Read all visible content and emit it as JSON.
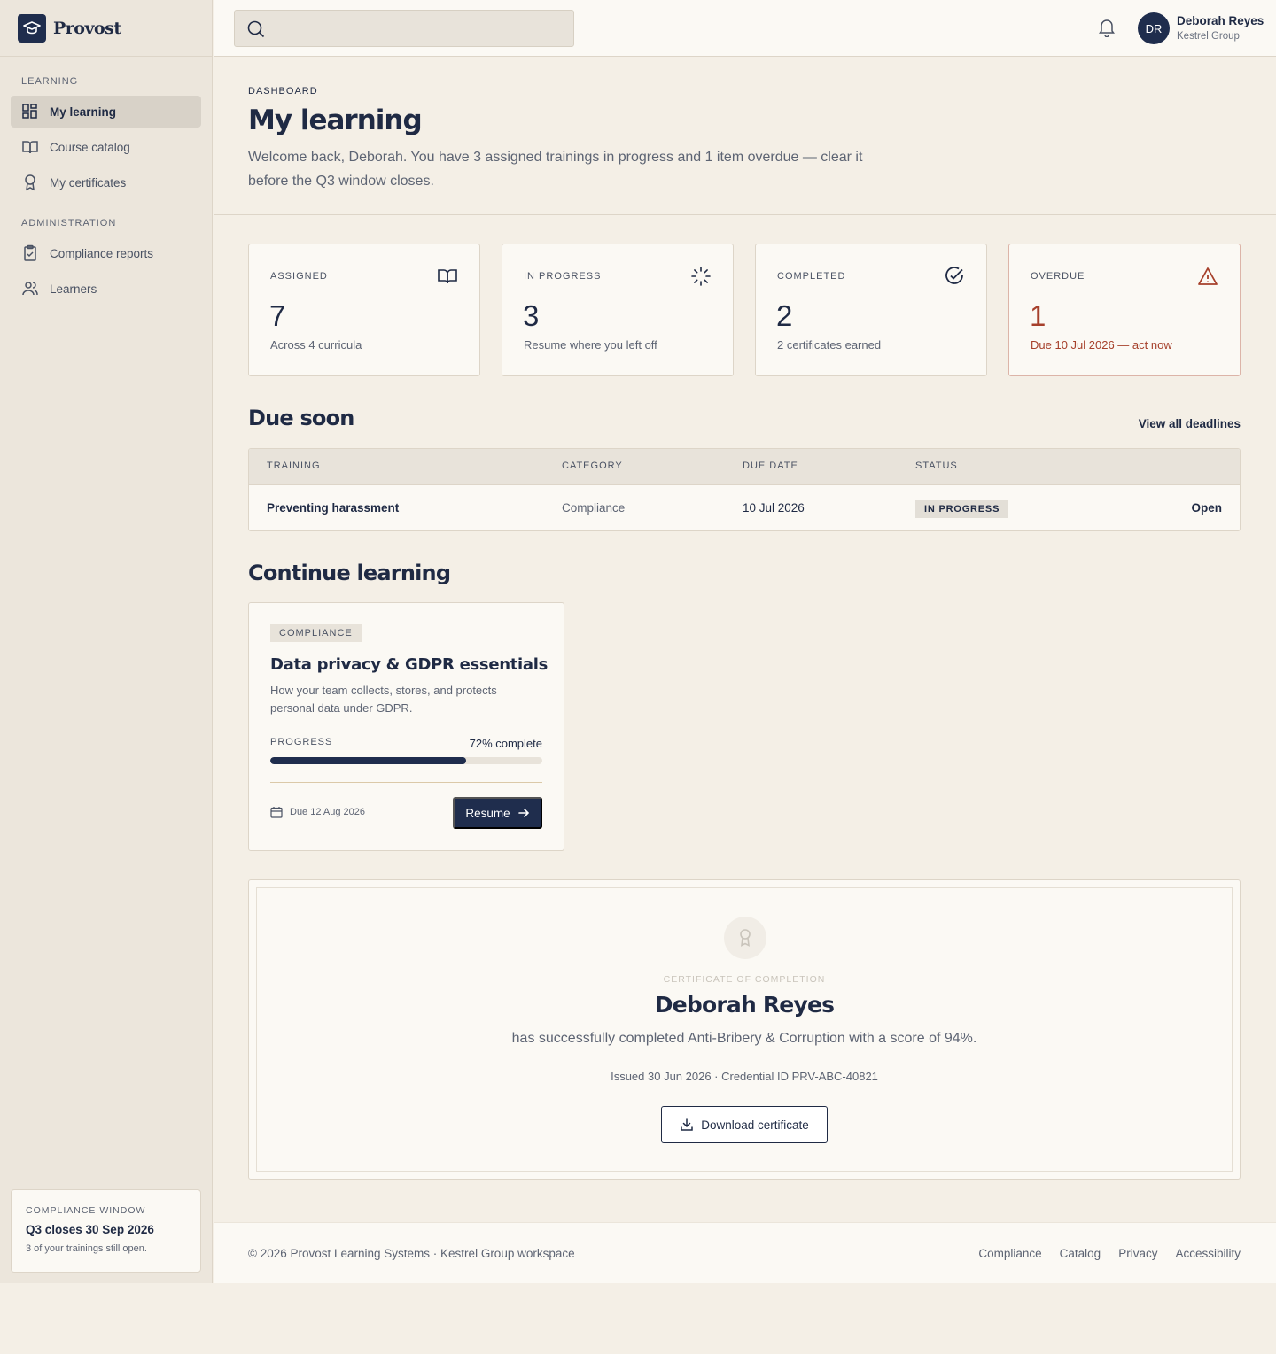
{
  "brand": {
    "name": "Provost"
  },
  "sidebar": {
    "sections": [
      {
        "label": "LEARNING"
      },
      {
        "label": "ADMINISTRATION"
      }
    ],
    "items": [
      {
        "label": "My learning",
        "icon": "dashboard-icon",
        "active": true
      },
      {
        "label": "Course catalog",
        "icon": "book-icon"
      },
      {
        "label": "My certificates",
        "icon": "award-icon"
      },
      {
        "label": "Compliance reports",
        "icon": "clipboard-check-icon"
      },
      {
        "label": "Learners",
        "icon": "users-icon"
      }
    ],
    "compliance_window": {
      "label": "COMPLIANCE WINDOW",
      "title": "Q3 closes 30 Sep 2026",
      "note": "3 of your trainings still open."
    }
  },
  "topbar": {
    "search_placeholder": "",
    "user": {
      "initials": "DR",
      "name": "Deborah Reyes",
      "org": "Kestrel Group"
    }
  },
  "header": {
    "breadcrumb": "DASHBOARD",
    "title": "My learning",
    "subtitle": "Welcome back, Deborah. You have 3 assigned trainings in progress and 1 item overdue — clear it before the Q3 window closes."
  },
  "stats": [
    {
      "label": "ASSIGNED",
      "value": "7",
      "desc": "Across 4 curricula",
      "icon": "book-open-icon"
    },
    {
      "label": "IN PROGRESS",
      "value": "3",
      "desc": "Resume where you left off",
      "icon": "loader-icon"
    },
    {
      "label": "COMPLETED",
      "value": "2",
      "desc": "2 certificates earned",
      "icon": "check-circle-icon"
    },
    {
      "label": "OVERDUE",
      "value": "1",
      "desc": "Due 10 Jul 2026 — act now",
      "icon": "alert-triangle-icon"
    }
  ],
  "due_soon": {
    "title": "Due soon",
    "view_all": "View all deadlines",
    "columns": [
      "TRAINING",
      "CATEGORY",
      "DUE DATE",
      "STATUS"
    ],
    "rows": [
      {
        "training": "Preventing harassment",
        "category": "Compliance",
        "due": "10 Jul 2026",
        "status": "IN PROGRESS",
        "action": "Open"
      }
    ]
  },
  "continue": {
    "title": "Continue learning",
    "course": {
      "tag": "COMPLIANCE",
      "title": "Data privacy & GDPR essentials",
      "desc": "How your team collects, stores, and protects personal data under GDPR.",
      "progress_label": "PROGRESS",
      "progress_text": "72% complete",
      "progress": 72,
      "due": "Due 12 Aug 2026",
      "button": "Resume"
    }
  },
  "certificate": {
    "label": "CERTIFICATE OF COMPLETION",
    "name": "Deborah Reyes",
    "text": "has successfully completed Anti-Bribery & Corruption with a score of 94%.",
    "meta": "Issued 30 Jun 2026 · Credential ID PRV-ABC-40821",
    "button": "Download certificate"
  },
  "footer": {
    "copyright": "© 2026 Provost Learning Systems · Kestrel Group workspace",
    "links": [
      "Compliance",
      "Catalog",
      "Privacy",
      "Accessibility"
    ]
  },
  "colors": {
    "primary": "#1f2d4d",
    "danger": "#a6402b",
    "background": "#f4efe6"
  }
}
